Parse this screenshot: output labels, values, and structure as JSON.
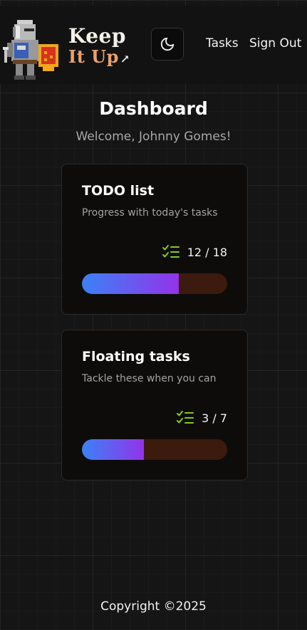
{
  "header": {
    "brand_line1": "Keep",
    "brand_line2": "It Up",
    "theme_icon": "moon-icon",
    "nav": {
      "tasks": "Tasks",
      "sign_out": "Sign Out"
    }
  },
  "main": {
    "title": "Dashboard",
    "welcome": "Welcome, Johnny Gomes!"
  },
  "cards": [
    {
      "title": "TODO list",
      "description": "Progress with today's tasks",
      "count_text": "12 / 18",
      "completed": 12,
      "total": 18,
      "icon": "checklist-icon"
    },
    {
      "title": "Floating tasks",
      "description": "Tackle these when you can",
      "count_text": "3 / 7",
      "completed": 3,
      "total": 7,
      "icon": "checklist-icon"
    }
  ],
  "footer": {
    "copyright": "Copyright ©2025"
  },
  "colors": {
    "accent_orange": "#e9a06b",
    "progress_start": "#3b82f6",
    "progress_end": "#9333ea",
    "progress_track": "#3c1a0d",
    "check_green": "#84cc16"
  }
}
